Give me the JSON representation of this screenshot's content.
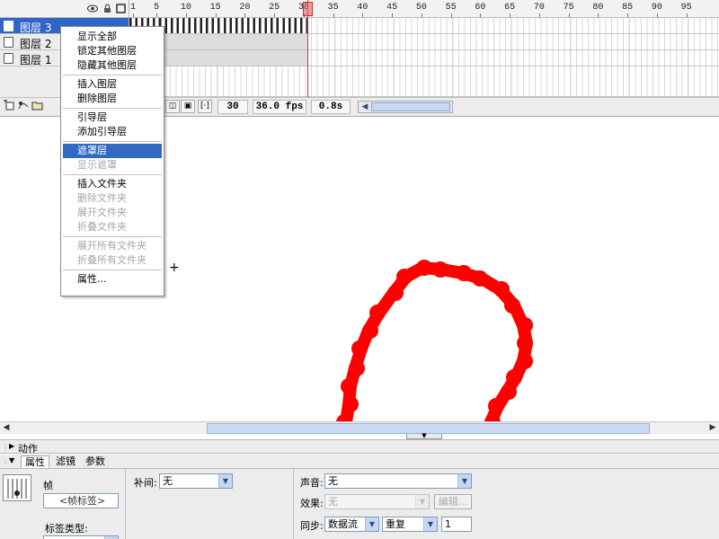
{
  "timeline": {
    "ruler_ticks": [
      "1",
      "5",
      "10",
      "15",
      "20",
      "25",
      "30",
      "35",
      "40",
      "45",
      "50",
      "55",
      "60",
      "65",
      "70",
      "75",
      "80",
      "85",
      "90",
      "95"
    ],
    "layers": [
      {
        "name": "图层 3",
        "selected": true
      },
      {
        "name": "图层 2",
        "selected": false
      },
      {
        "name": "图层 1",
        "selected": false
      }
    ],
    "current_frame": "30",
    "fps": "36.0 fps",
    "time": "0.8s",
    "header_icons": [
      "eye-icon",
      "lock-icon",
      "outline-icon"
    ]
  },
  "context_menu": {
    "items": [
      {
        "label": "显示全部",
        "enabled": true
      },
      {
        "label": "锁定其他图层",
        "enabled": true
      },
      {
        "label": "隐藏其他图层",
        "enabled": true
      },
      {
        "sep": true
      },
      {
        "label": "插入图层",
        "enabled": true
      },
      {
        "label": "删除图层",
        "enabled": true
      },
      {
        "sep": true
      },
      {
        "label": "引导层",
        "enabled": true
      },
      {
        "label": "添加引导层",
        "enabled": true
      },
      {
        "sep": true
      },
      {
        "label": "遮罩层",
        "enabled": true,
        "highlighted": true
      },
      {
        "label": "显示遮罩",
        "enabled": false
      },
      {
        "sep": true
      },
      {
        "label": "插入文件夹",
        "enabled": true
      },
      {
        "label": "删除文件夹",
        "enabled": false
      },
      {
        "label": "展开文件夹",
        "enabled": false
      },
      {
        "label": "折叠文件夹",
        "enabled": false
      },
      {
        "sep": true
      },
      {
        "label": "展开所有文件夹",
        "enabled": false
      },
      {
        "label": "折叠所有文件夹",
        "enabled": false
      },
      {
        "sep": true
      },
      {
        "label": "属性...",
        "enabled": true
      }
    ]
  },
  "stage": {
    "stroke_color": "#ff0000"
  },
  "panels": {
    "actions_title": "动作",
    "tabs": [
      "属性",
      "滤镜",
      "参数"
    ],
    "frame_label": "帧",
    "frame_name_placeholder": "<帧标签>",
    "label_type": "标签类型:",
    "tween_label": "补间:",
    "tween_value": "无",
    "sound_label": "声音:",
    "sound_value": "无",
    "effect_label": "效果:",
    "effect_value": "无",
    "edit_button": "编辑...",
    "sync_label": "同步:",
    "sync_value": "数据流",
    "repeat_value": "重复",
    "repeat_count": "1"
  },
  "colors": {
    "selection": "#3165c4",
    "playhead": "#dd3333",
    "stroke": "#ff0000"
  }
}
